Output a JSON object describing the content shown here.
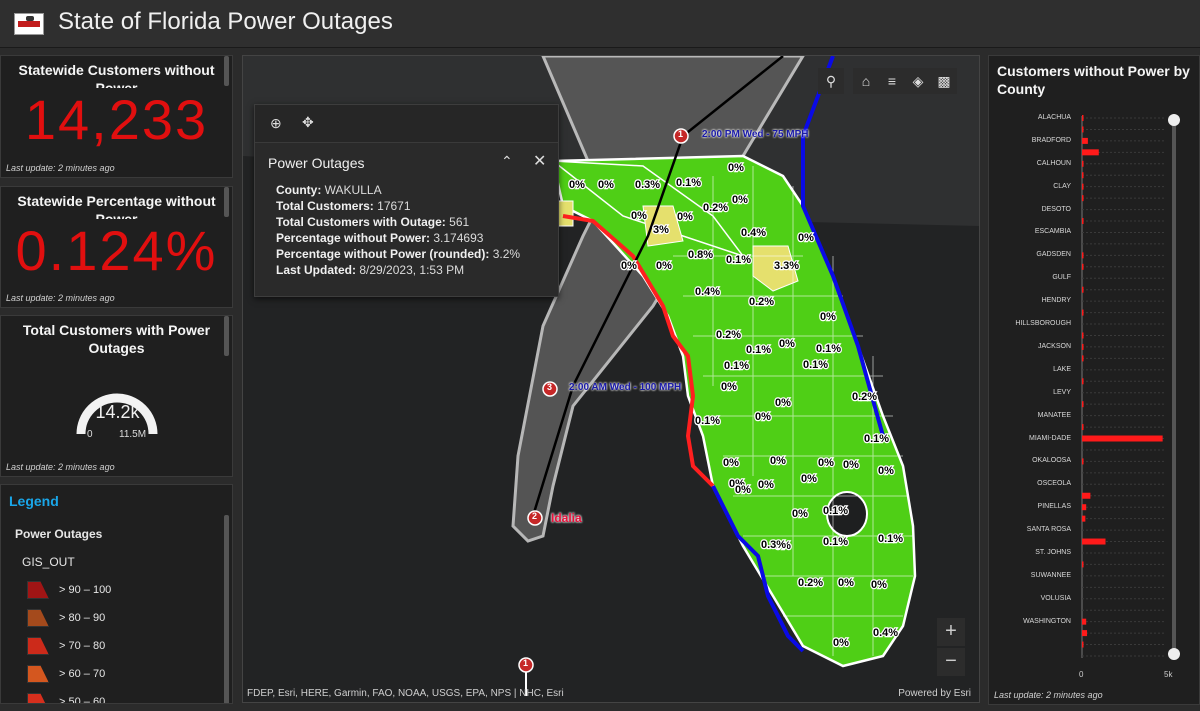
{
  "header": {
    "title": "State of Florida Power Outages"
  },
  "cards": {
    "customers": {
      "title": "Statewide Customers without Power",
      "value": "14,233",
      "updated": "Last update: 2 minutes ago"
    },
    "percentage": {
      "title": "Statewide Percentage without Power",
      "value": "0.124%",
      "updated": "Last update: 2 minutes ago"
    },
    "gauge": {
      "title": "Total Customers with Power Outages",
      "value": "14.2k",
      "min": "0",
      "max": "11.5M",
      "fraction": 0.00124,
      "updated": "Last update: 2 minutes ago"
    }
  },
  "legend": {
    "title": "Legend",
    "layer": "Power Outages",
    "sublayer": "GIS_OUT",
    "items": [
      {
        "label": "> 90 – 100",
        "color": "#a01515"
      },
      {
        "label": "> 80 – 90",
        "color": "#a44a1c"
      },
      {
        "label": "> 70 – 80",
        "color": "#cc2a1a"
      },
      {
        "label": "> 60 – 70",
        "color": "#d4571f"
      },
      {
        "label": "> 50 – 60",
        "color": "#d62f1d"
      }
    ]
  },
  "map": {
    "storm_name": "Idalia",
    "track_points": [
      {
        "num": "1",
        "label": "2:00 PM Wed - 75 MPH"
      },
      {
        "num": "3",
        "label": "2:00 AM Wed - 100 MPH"
      },
      {
        "num": "2",
        "label": "Idalia"
      },
      {
        "num": "1",
        "label": ""
      }
    ],
    "county_labels": [
      "0%",
      "0%",
      "0.3%",
      "0.1%",
      "0%",
      "0%",
      "0.2%",
      "0%",
      "0%",
      "3%",
      "0.4%",
      "0%",
      "0%",
      "0.8%",
      "0.1%",
      "3.3%",
      "0%",
      "0.4%",
      "0.2%",
      "0%",
      "0.2%",
      "0.1%",
      "0%",
      "0.1%",
      "0.1%",
      "0%",
      "0.1%",
      "0%",
      "0%",
      "0.2%",
      "0.1%",
      "0%",
      "0%",
      "0%",
      "0%",
      "0%",
      "0%",
      "0%",
      "0.1%",
      "0%",
      "0%",
      "0.1%",
      "0%",
      "0%",
      "0.1%",
      "0.3%",
      "0.1%",
      "0%",
      "0.2%",
      "0%",
      "0.4%",
      "0%"
    ],
    "attribution": "FDEP, Esri, HERE, Garmin, FAO, NOAA, USGS, EPA, NPS | NHC, Esri",
    "powered": "Powered by Esri",
    "zoom_in": "+",
    "zoom_out": "−"
  },
  "popup": {
    "title": "Power Outages",
    "fields": [
      {
        "label": "County:",
        "value": "WAKULLA"
      },
      {
        "label": "Total Customers:",
        "value": "17671"
      },
      {
        "label": "Total Customers with Outage:",
        "value": "561"
      },
      {
        "label": "Percentage without Power:",
        "value": "3.174693"
      },
      {
        "label": "Percentage without Power (rounded):",
        "value": "3.2%"
      },
      {
        "label": "Last Updated:",
        "value": "8/29/2023, 1:53 PM"
      }
    ]
  },
  "county_chart": {
    "title": "Customers without Power by County",
    "updated": "Last update: 2 minutes ago",
    "axis_min": "0",
    "axis_max": "5k",
    "labels": [
      "ALACHUA",
      "BRADFORD",
      "CALHOUN",
      "CLAY",
      "DESOTO",
      "ESCAMBIA",
      "GADSDEN",
      "GULF",
      "HENDRY",
      "HILLSBOROUGH",
      "JACKSON",
      "LAKE",
      "LEVY",
      "MANATEE",
      "MIAMI-DADE",
      "OKALOOSA",
      "OSCEOLA",
      "PINELLAS",
      "SANTA ROSA",
      "ST. JOHNS",
      "SUWANNEE",
      "VOLUSIA",
      "WASHINGTON"
    ]
  },
  "chart_data": {
    "type": "bar",
    "title": "Customers without Power by County",
    "xlim": [
      0,
      5000
    ],
    "series": [
      {
        "values": [
          60,
          30,
          350,
          1000,
          20,
          20,
          10,
          10,
          0,
          10,
          0,
          0,
          10,
          10,
          0,
          10,
          0,
          10,
          0,
          20,
          10,
          15,
          0,
          10,
          0,
          40,
          0,
          10,
          4800,
          0,
          20,
          0,
          0,
          500,
          250,
          200,
          0,
          1400,
          0,
          60,
          0,
          0,
          0,
          0,
          250,
          300,
          10,
          0
        ]
      }
    ]
  }
}
